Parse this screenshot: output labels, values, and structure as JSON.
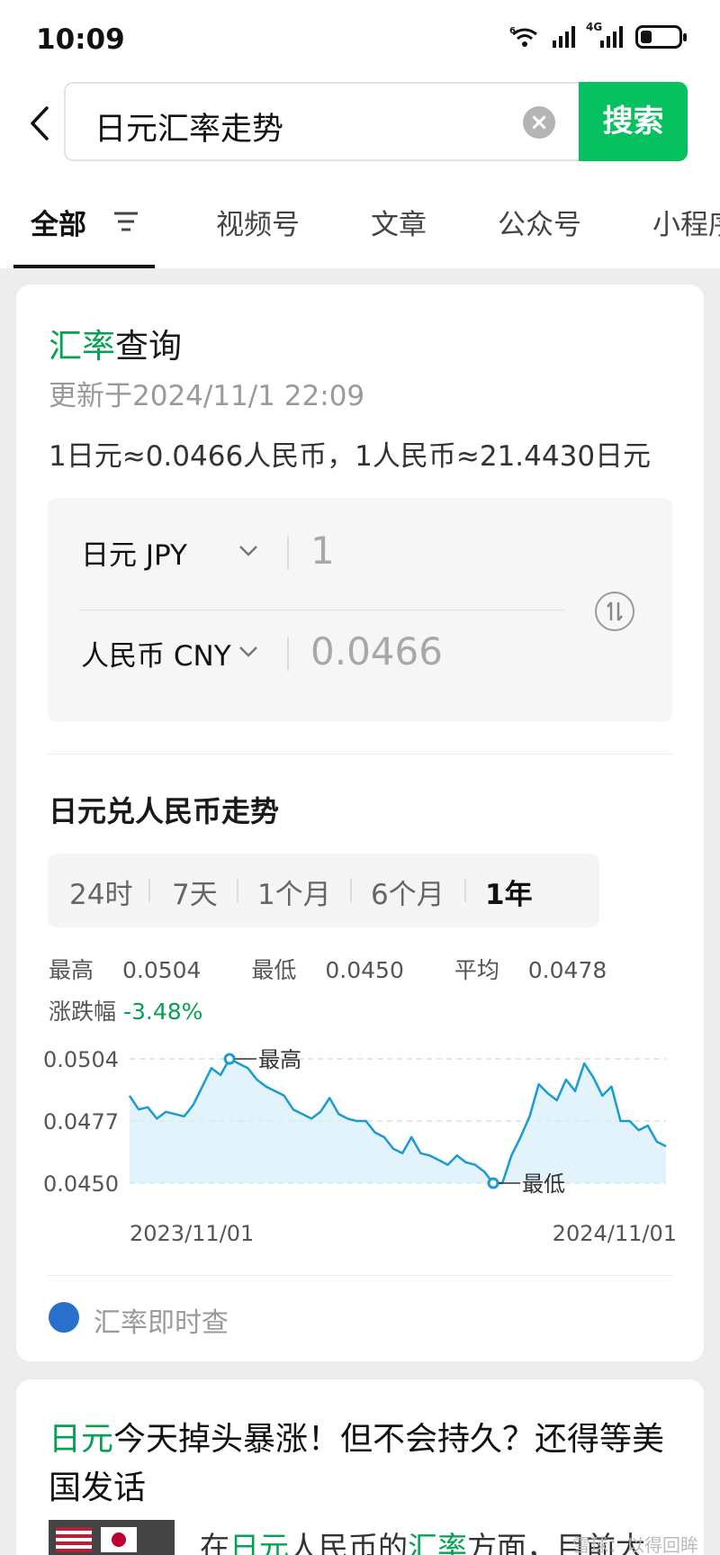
{
  "status_bar": {
    "time": "10:09",
    "wifi_label": "6",
    "network_label": "4G"
  },
  "search": {
    "query": "日元汇率走势",
    "button_label": "搜索"
  },
  "tabs": [
    {
      "label": "全部",
      "active": true
    },
    {
      "label": "视频号"
    },
    {
      "label": "文章"
    },
    {
      "label": "公众号"
    },
    {
      "label": "小程序"
    }
  ],
  "rate_card": {
    "title_prefix": "汇率",
    "title_suffix": "查询",
    "updated": "更新于2024/11/1 22:09",
    "rate_line": "1日元≈0.0466人民币，1人民币≈21.4430日元",
    "from_currency": "日元 JPY",
    "from_amount": "1",
    "to_currency": "人民币 CNY",
    "to_amount": "0.0466",
    "trend_title": "日元兑人民币走势",
    "periods": [
      "24时",
      "7天",
      "1个月",
      "6个月",
      "1年"
    ],
    "active_period": "1年",
    "stats": {
      "high_label": "最高",
      "high": "0.0504",
      "low_label": "最低",
      "low": "0.0450",
      "avg_label": "平均",
      "avg": "0.0478"
    },
    "change_label": "涨跌幅",
    "change": "-3.48%",
    "source": "汇率即时查"
  },
  "chart_data": {
    "type": "area",
    "x_start": "2023/11/01",
    "x_end": "2024/11/01",
    "y_ticks": [
      "0.0504",
      "0.0477",
      "0.0450"
    ],
    "ylim": [
      0.045,
      0.0504
    ],
    "high_label": "最高",
    "low_label": "最低",
    "high_value": 0.0504,
    "low_value": 0.045,
    "values": [
      0.0488,
      0.0482,
      0.0483,
      0.0478,
      0.0481,
      0.048,
      0.0479,
      0.0484,
      0.0492,
      0.05,
      0.0497,
      0.0504,
      0.0502,
      0.05,
      0.0495,
      0.0492,
      0.049,
      0.0488,
      0.0482,
      0.048,
      0.0478,
      0.0481,
      0.0487,
      0.048,
      0.0478,
      0.0477,
      0.0477,
      0.0472,
      0.047,
      0.0465,
      0.0463,
      0.047,
      0.0463,
      0.0462,
      0.046,
      0.0458,
      0.0462,
      0.0459,
      0.0458,
      0.0455,
      0.045,
      0.045,
      0.0462,
      0.047,
      0.0479,
      0.0493,
      0.0489,
      0.0486,
      0.0495,
      0.049,
      0.0502,
      0.0496,
      0.0488,
      0.0492,
      0.0477,
      0.0477,
      0.0473,
      0.0475,
      0.0468,
      0.0466
    ],
    "accent": "#1a9bd1",
    "fill": "#d6eefa"
  },
  "article": {
    "title_prefix": "日元",
    "title_rest": "今天掉头暴涨！但不会持久？还得等美国发话",
    "snippet_a": "在",
    "snippet_b": "日元",
    "snippet_c": "人民币的",
    "snippet_d": "汇率",
    "snippet_e": "方面，目前大"
  },
  "watermark": "雪球：以得回眸",
  "colors": {
    "accent_green": "#07c160",
    "link_green": "#07a153"
  }
}
